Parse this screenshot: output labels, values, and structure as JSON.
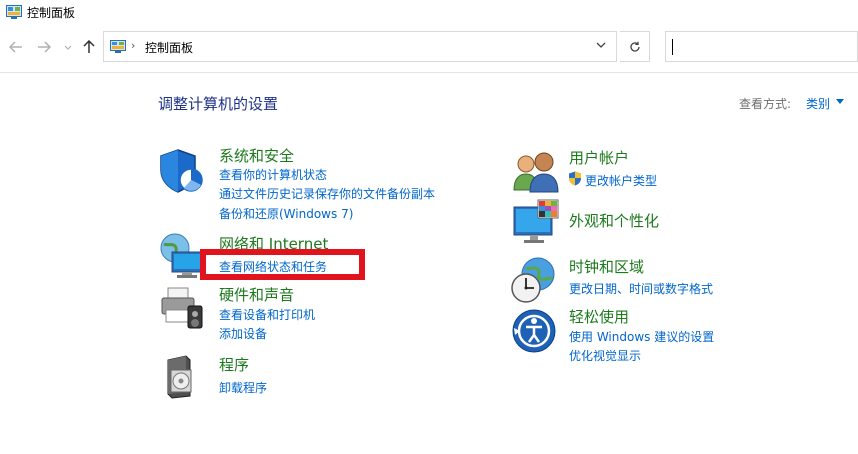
{
  "window": {
    "title": "控制面板"
  },
  "address": {
    "breadcrumb": "控制面板",
    "separator": "›"
  },
  "heading": "调整计算机的设置",
  "view_by": {
    "label": "查看方式:",
    "value": "类别"
  },
  "left_categories": [
    {
      "title": "系统和安全",
      "icon": "shield-icon",
      "links": [
        "查看你的计算机状态",
        "通过文件历史记录保存你的文件备份副本",
        "备份和还原(Windows 7)"
      ]
    },
    {
      "title": "网络和 Internet",
      "icon": "network-globe-icon",
      "links": [
        "查看网络状态和任务"
      ]
    },
    {
      "title": "硬件和声音",
      "icon": "printer-speaker-icon",
      "links": [
        "查看设备和打印机",
        "添加设备"
      ]
    },
    {
      "title": "程序",
      "icon": "programs-disc-icon",
      "links": [
        "卸载程序"
      ]
    }
  ],
  "right_categories": [
    {
      "title": "用户帐户",
      "icon": "users-icon",
      "links": [
        "更改帐户类型"
      ]
    },
    {
      "title": "外观和个性化",
      "icon": "monitor-palette-icon",
      "links": []
    },
    {
      "title": "时钟和区域",
      "icon": "clock-globe-icon",
      "links": [
        "更改日期、时间或数字格式"
      ]
    },
    {
      "title": "轻松使用",
      "icon": "ease-of-access-icon",
      "links": [
        "使用 Windows 建议的设置",
        "优化视觉显示"
      ]
    }
  ],
  "colors": {
    "link": "#0066cc",
    "category_title": "#1c7a1c",
    "heading": "#1e3287",
    "highlight": "#e1141e"
  }
}
